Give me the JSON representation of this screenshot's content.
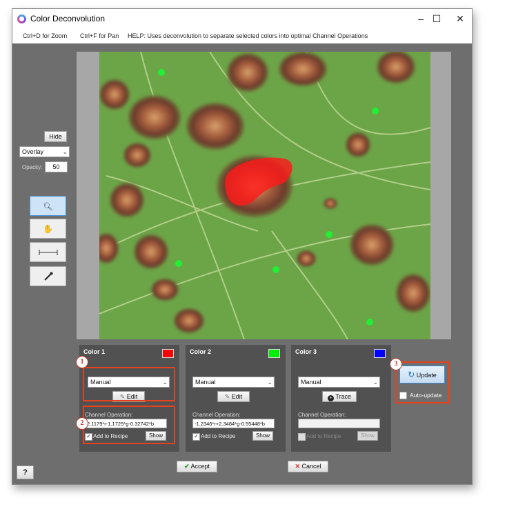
{
  "window": {
    "title": "Color Deconvolution",
    "controls": {
      "minimize": "–",
      "maximize": "☐",
      "close": "✕"
    }
  },
  "menubar": {
    "zoom_hint": "Ctrl+D for Zoom",
    "pan_hint": "Ctrl+F for Pan",
    "help": "HELP:  Uses deconvolution to separate selected colors into optimal Channel Operations"
  },
  "sidebar": {
    "hide_label": "Hide",
    "overlay_value": "Overlay",
    "opacity_label": "Opacity:",
    "opacity_value": "50",
    "tools": [
      "zoom-tool",
      "pan-tool",
      "measure-tool",
      "eyedropper-tool"
    ]
  },
  "colors": [
    {
      "title": "Color 1",
      "swatch": "#ff0000",
      "mode": "Manual",
      "action_label": "Edit",
      "channel_label": "Channel Operation:",
      "channel_op": "2.1179*r-1.1725*g-0.32742*b",
      "add_label": "Add to Recipe",
      "show_label": "Show",
      "added": true
    },
    {
      "title": "Color 2",
      "swatch": "#00ee00",
      "mode": "Manual",
      "action_label": "Edit",
      "channel_label": "Channel Operation:",
      "channel_op": "-1.2346*r+2.3484*g-0.55448*b",
      "add_label": "Add to Recipe",
      "show_label": "Show",
      "added": true
    },
    {
      "title": "Color 3",
      "swatch": "#0000ff",
      "mode": "Manual",
      "action_label": "Trace",
      "channel_label": "Channel Operation:",
      "channel_op": "",
      "add_label": "Add to Recipe",
      "show_label": "Show",
      "added": false
    }
  ],
  "update": {
    "label": "Update",
    "auto_label": "Auto-update"
  },
  "badges": [
    "1",
    "2",
    "3"
  ],
  "footer": {
    "help": "?",
    "accept": "Accept",
    "cancel": "Cancel"
  },
  "accent": "#e8411c"
}
